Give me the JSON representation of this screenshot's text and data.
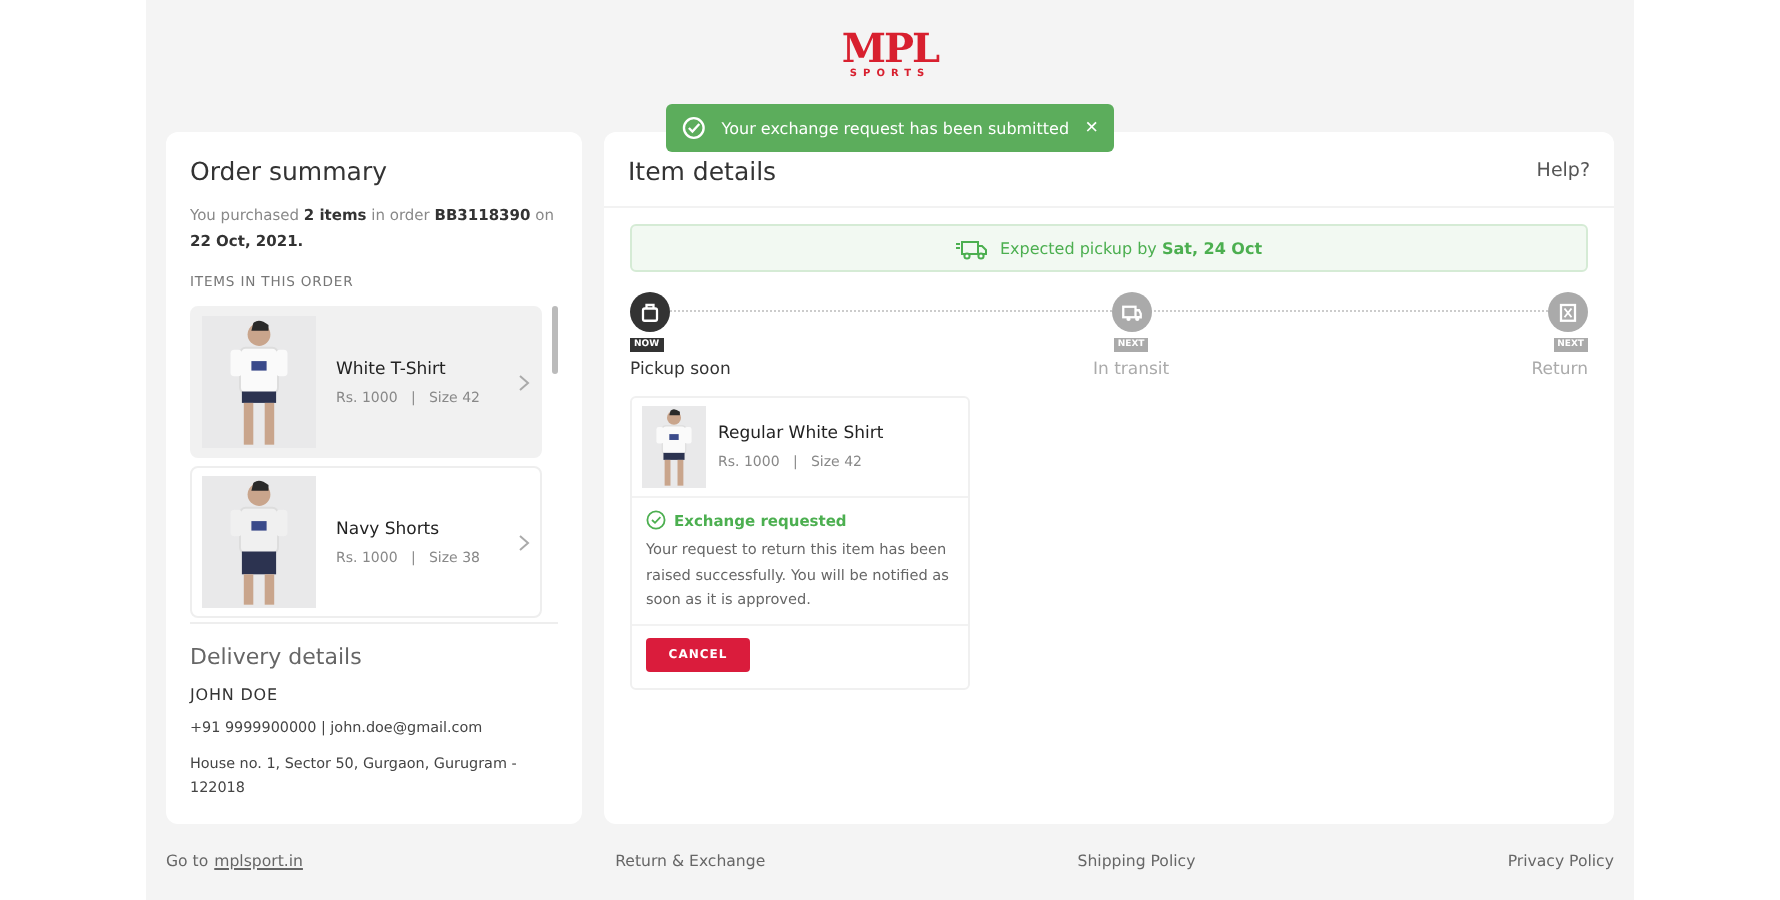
{
  "logo": {
    "mark": "MPL",
    "sub": "SPORTS"
  },
  "toast": {
    "message": "Your exchange request has been submitted",
    "close": "×"
  },
  "order_summary": {
    "title": "Order summary",
    "text": "You purchased **2 items** in order **BB3118390** on **22 Oct, 2021.**",
    "items_heading": "ITEMS IN THIS ORDER",
    "items": [
      {
        "name": "White T-Shirt",
        "details": "Rs. 1000   |   Size 42",
        "selected": true,
        "kind": "picture"
      },
      {
        "name": "Navy Shorts",
        "details": "Rs. 1000   |   Size 38",
        "selected": false,
        "kind": "picture"
      }
    ]
  },
  "delivery": {
    "title": "Delivery details",
    "name": "JOHN DOE",
    "contact": "+91 9999900000 | john.doe@gmail.com",
    "address": "House no. 1, Sector 50, Gurgaon, Gurugram - 122018"
  },
  "item_details": {
    "title": "Item details",
    "help": "Help?",
    "pickup_banner": "Expected pickup by **Sat, 24 Oct**",
    "steps": [
      {
        "label": "Pickup soon",
        "badge": "NOW",
        "active": true
      },
      {
        "label": "In transit",
        "badge": "NEXT",
        "active": false
      },
      {
        "label": "Return",
        "badge": "NEXT",
        "active": false
      }
    ],
    "item": {
      "name": "Regular White Shirt",
      "details": "Rs. 1000   |   Size 42",
      "kind": "picture",
      "status": "Exchange requested",
      "message": "Your request to return this item has been raised successfully. You will be notified as soon as it is approved.",
      "cancel": "CANCEL"
    }
  },
  "footer": {
    "goto_prefix": "Go to",
    "goto_link": "mplsport.in",
    "links": [
      "Return & Exchange",
      "Shipping Policy",
      "Privacy Policy"
    ]
  }
}
